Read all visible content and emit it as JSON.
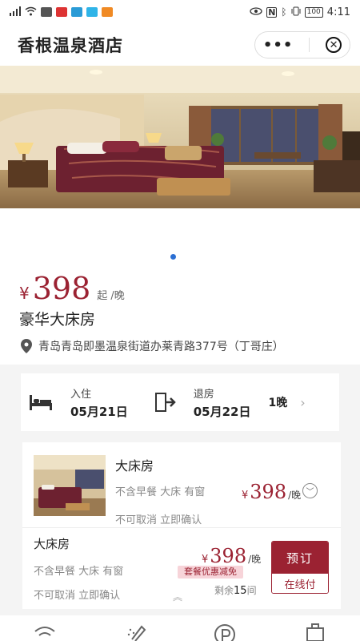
{
  "status_bar": {
    "time": "4:11",
    "battery": "100"
  },
  "header": {
    "title": "香根温泉酒店",
    "more_glyph": "•••",
    "close_glyph": "✕"
  },
  "gallery": {
    "carousel_dots": 1
  },
  "hotel": {
    "price_currency": "¥",
    "price": "398",
    "price_suffix": "起 /晚",
    "room_type": "豪华大床房",
    "address": "青岛青岛即墨温泉街道办莱青路377号（丁哥庄）"
  },
  "stay": {
    "checkin_label": "入住",
    "checkin_date": "05月21日",
    "checkout_label": "退房",
    "checkout_date": "05月22日",
    "nights": "1晚"
  },
  "room": {
    "name": "大床房",
    "tags_line1": "不含早餐  大床  有窗",
    "tags_line2": "不可取消  立即确认",
    "currency": "¥",
    "price": "398",
    "per": "/晚"
  },
  "package": {
    "name": "大床房",
    "tags_line1": "不含早餐  大床  有窗",
    "tags_line2": "不可取消  立即确认",
    "currency": "¥",
    "price": "398",
    "per": "/晚",
    "promo": "套餐优惠减免",
    "remain_prefix": "剩余",
    "remain_count": "15",
    "remain_suffix": "间",
    "book_label": "预订",
    "pay_label": "在线付"
  },
  "facilities": [
    "wifi-icon",
    "bath-icon",
    "parking-icon",
    "luggage-icon"
  ],
  "colors": {
    "accent": "#9b2232",
    "dot": "#2b6fd3",
    "promo_bg": "#f7d4d9"
  }
}
